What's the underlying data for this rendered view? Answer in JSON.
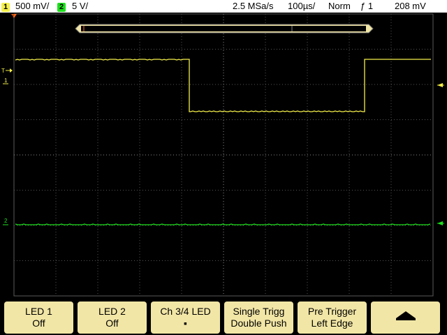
{
  "status": {
    "ch1_number": "1",
    "ch1_scale": "500 mV/",
    "ch2_number": "2",
    "ch2_scale": "5 V/",
    "sample_rate": "2.5 MSa/s",
    "timebase": "100µs/",
    "trigger_mode": "Norm",
    "trigger_source": "ƒ 1",
    "trigger_level": "208 mV"
  },
  "markers": {
    "trigger_time_marker": "T",
    "trigger_level_marker": "T",
    "ch1_marker": "1",
    "ch2_marker": "2"
  },
  "softkeys": [
    {
      "line1": "LED 1",
      "line2": "Off"
    },
    {
      "line1": "LED 2",
      "line2": "Off"
    },
    {
      "line1": "Ch 3/4 LED",
      "line2": "▪"
    },
    {
      "line1": "Single Trigg",
      "line2": "Double Push"
    },
    {
      "line1": "Pre Trigger",
      "line2": "Left Edge"
    },
    {
      "line1": "",
      "line2": ""
    }
  ],
  "colors": {
    "ch1": "#f5f04a",
    "ch2": "#1fe01f",
    "trigger_marker": "#ff6a1a",
    "softkey_bg": "#f2e6a6"
  },
  "icons": {
    "back": "up-arrow-icon"
  }
}
